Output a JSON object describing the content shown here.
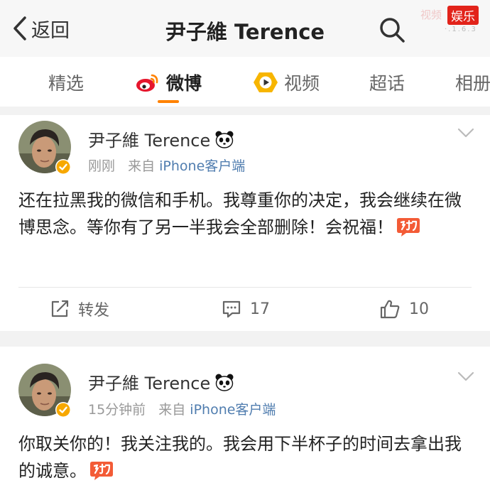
{
  "header": {
    "back_label": "返回",
    "title": "尹子維 Terence",
    "watermark_site": "视频",
    "watermark_badge": "娱乐",
    "watermark_sub": "·.1.6.3"
  },
  "tabs": [
    {
      "label": "精选",
      "icon": null,
      "active": false
    },
    {
      "label": "微博",
      "icon": "weibo-logo-icon",
      "active": true
    },
    {
      "label": "视频",
      "icon": "video-play-icon",
      "active": false
    },
    {
      "label": "超话",
      "icon": null,
      "active": false
    },
    {
      "label": "相册",
      "icon": null,
      "active": false
    }
  ],
  "posts": [
    {
      "author": "尹子維 Terence",
      "author_badge_icon": "panda-icon",
      "time": "刚刚",
      "source_prefix": "来自",
      "source": "iPhone客户端",
      "text": "还在拉黑我的微信和手机。我尊重你的决定，我会继续在微博思念。等你有了另一半我会全部删除！会祝福！",
      "emoji_icon": "jiayou-emoji-icon",
      "actions": {
        "repost": "转发",
        "comments": "17",
        "likes": "10"
      }
    },
    {
      "author": "尹子維 Terence",
      "author_badge_icon": "panda-icon",
      "time": "15分钟前",
      "source_prefix": "来自",
      "source": "iPhone客户端",
      "text": "你取关你的！我关注我的。我会用下半杯子的时间去拿出我的诚意。",
      "emoji_icon": "jiayou-emoji-icon"
    }
  ],
  "colors": {
    "accent": "#ff8200",
    "link": "#507daf",
    "verified": "#f7a800",
    "weibo_red": "#e6162d",
    "watermark_red": "#e2231a"
  }
}
